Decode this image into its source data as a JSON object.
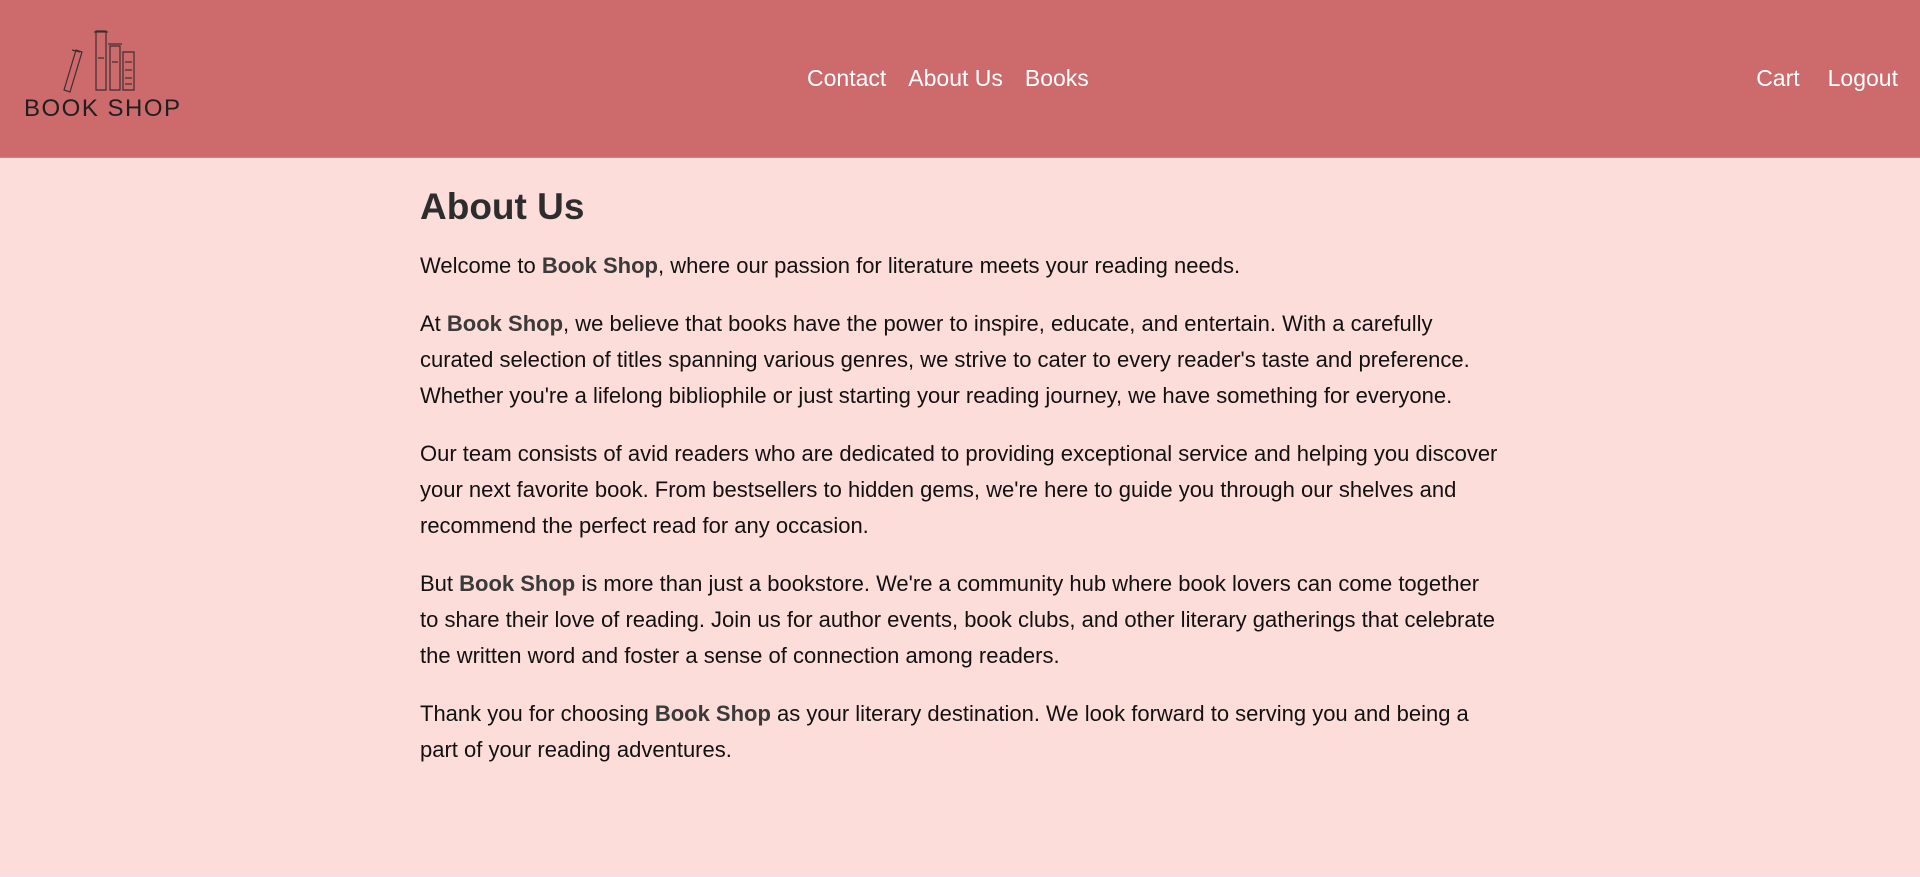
{
  "header": {
    "logo": {
      "text": "BOOK SHOP",
      "icon": "books-logo-icon"
    },
    "nav": {
      "contact": "Contact",
      "about": "About Us",
      "books": "Books"
    },
    "actions": {
      "cart": "Cart",
      "logout": "Logout"
    }
  },
  "main": {
    "title": "About Us",
    "p1": {
      "before": "Welcome to ",
      "brand": "Book Shop",
      "after": ", where our passion for literature meets your reading needs."
    },
    "p2": {
      "before": "At ",
      "brand": "Book Shop",
      "after": ", we believe that books have the power to inspire, educate, and entertain. With a carefully curated selection of titles spanning various genres, we strive to cater to every reader's taste and preference. Whether you're a lifelong bibliophile or just starting your reading journey, we have something for everyone."
    },
    "p3": {
      "text": "Our team consists of avid readers who are dedicated to providing exceptional service and helping you discover your next favorite book. From bestsellers to hidden gems, we're here to guide you through our shelves and recommend the perfect read for any occasion."
    },
    "p4": {
      "before": "But ",
      "brand": "Book Shop",
      "after": " is more than just a bookstore. We're a community hub where book lovers can come together to share their love of reading. Join us for author events, book clubs, and other literary gatherings that celebrate the written word and foster a sense of connection among readers."
    },
    "p5": {
      "before": "Thank you for choosing ",
      "brand": "Book Shop",
      "after": " as your literary destination. We look forward to serving you and being a part of your reading adventures."
    }
  },
  "colors": {
    "header_bg": "#cd6a6c",
    "page_bg": "#fdddda",
    "nav_text": "#ffffff",
    "body_text": "#111111"
  }
}
